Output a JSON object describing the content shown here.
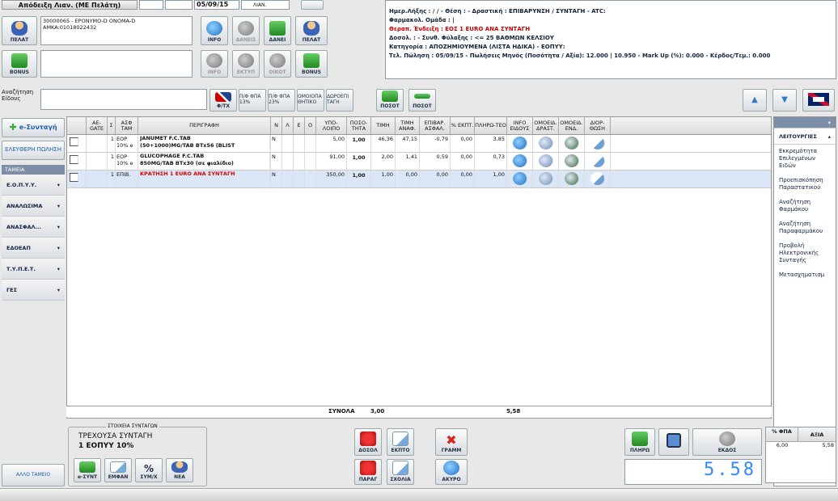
{
  "top": {
    "receipt_title": "Απόδειξη Λιαν. (ΜΕ Πελάτη)",
    "date": "05/09/15",
    "type": "ΛΙΑΝ."
  },
  "patient": {
    "line1": "30000065 - EPONYMO-D ONOMA-D",
    "line2": "AMKA:01018022432"
  },
  "buttons": {
    "pelat": "ΠΕΛΑΤ",
    "info": "INFO",
    "daneis": "ΔΑΝΕΙΣ",
    "daneis2": "ΔΑΝΕΙ",
    "pelat2": "ΠΕΛΑΤ",
    "bonus": "BONUS",
    "info2": "INFO",
    "ekty": "ΕΚΤΥΠ",
    "oikot": "ΟΙΚΟΤ",
    "bonus2": "BONUS",
    "search": "Αναζήτηση Είδους",
    "fpa_tx": "Φ/ΤΧ",
    "pf13": "Π/Φ ΦΠΑ 13%",
    "pf23": "Π/Φ ΦΠΑ 23%",
    "omoiop": "ΟΜΟΙΟΠΑ ΘΗΤΙΚΟ",
    "dwroep": "ΔΩΡΟΕΠΙ ΤΑΓΗ",
    "poso1": "ΠΟΣΟΤ",
    "poso2": "ΠΟΣΟΤ"
  },
  "info_panel": {
    "l1": "Ημερ.Λήξης :  / /  - Θέση :  - Δραστική : ΕΠΙΒΑΡΥΝΣΗ / ΣΥΝΤΑΓΗ - ATC:",
    "l2": "Φαρμακολ. Ομάδα : |",
    "l3": "Θεραπ. Ένδειξη : ΕΟΣ 1 EURO ΑΝΑ ΣΥΝΤΑΓΗ",
    "l4": "Δοσολ. :  - Συνθ. Φύλαξης : <= 25 ΒΑΘΜΩΝ ΚΕΛΣΙΟΥ",
    "l5": "Κατηγορία : ΑΠΟΖΗΜΙΟΥΜΕΝΑ (ΛΙΣΤΑ ΗΔΙΚΑ) - ΕΟΠΥΥ:",
    "l6": "Τελ. Πώληση : 05/09/15 - Πωλήσεις Μηνός (Ποσότητα / Αξία): 12.000 | 10.950 - Mark Up (%): 0.000 - Κέρδος/Τεμ.: 0.000"
  },
  "left_nav": {
    "esyntagi": "e-Συνταγή",
    "free": "ΕΛΕΥΘΕΡΗ ΠΩΛΗΣΗ",
    "tameia": "ΤΑΜΕΙΑ",
    "items": [
      "Ε.Ο.Π.Υ.Υ.",
      "ΑΝΑΛΩΣΙΜΑ",
      "ΑΝΑΣΦΑΛ...",
      "ΕΔΟΕΑΠ",
      "Τ.Υ.Π.Ε.Τ.",
      "ΓΕΣ"
    ],
    "other": "ΑΛΛΟ ΤΑΜΕΙΟ"
  },
  "grid": {
    "headers": [
      "ΑΕ-GATE",
      "Σ",
      "ΑΣΦ ΤΑΜ",
      "ΠΕΡΙΓΡΑΦΗ",
      "Ν",
      "Λ",
      "Ε",
      "Ο",
      "ΥΠΟ-ΛΟΙΠΟ",
      "ΠΟΣΟ-ΤΗΤΑ",
      "ΤΙΜΗ",
      "ΤΙΜΗ ΑΝΑΦ.",
      "ΕΠΙΒΑΡ. ΑΣΦΑΛ.",
      "% ΕΚΠΤ.",
      "ΠΛΗΡΩ-ΤΕΟ",
      "INFO ΕΙΔΟΥΣ",
      "ΟΜΟΕΙΔ. ΔΡΑΣΤ.",
      "ΟΜΟΕΙΔ. ΕΝΔ.",
      "ΔΙΟΡ-ΘΩΣΗ"
    ],
    "rows": [
      {
        "s": "1",
        "asf": "EOP 10% e",
        "desc1": "JANUMET F.C.TAB",
        "desc2": "(50+1000)MG/TAB BTx56 (BLIST",
        "n": "N",
        "ypol": "5,00",
        "qty": "1,00",
        "timi": "46,36",
        "anaf": "47,15",
        "epib": "-0,79",
        "ekpt": "0,00",
        "plir": "3,85",
        "red": false
      },
      {
        "s": "1",
        "asf": "EOP 10% e",
        "desc1": "GLUCOPHAGE F.C.TAB",
        "desc2": "850MG/TAB BTx30 (σε φιαλίδιο)",
        "n": "N",
        "ypol": "91,00",
        "qty": "1,00",
        "timi": "2,00",
        "anaf": "1,41",
        "epib": "0,59",
        "ekpt": "0,00",
        "plir": "0,73",
        "red": false
      },
      {
        "s": "1",
        "asf": "ΕΠΙΒ.",
        "desc1": "ΚΡΑΤΗΣΗ 1 EURO ΑΝΑ ΣΥΝΤΑΓΗ",
        "desc2": "",
        "n": "N",
        "ypol": "350,00",
        "qty": "1,00",
        "timi": "1,00",
        "anaf": "0,00",
        "epib": "0,00",
        "ekpt": "0,00",
        "plir": "1,00",
        "red": true
      }
    ],
    "totals_label": "ΣΥΝΟΛΑ",
    "totals_qty": "3,00",
    "totals_pay": "5,58"
  },
  "right_menu": {
    "title": "ΛΕΙΤΟΥΡΓΙΕΣ",
    "items": [
      "Εκκρεμότητα Επιλεγμένων Ειδών",
      "Προεπισκόπηση Παραστατικού",
      "Αναζήτηση Φαρμάκου",
      "Αναζήτηση Παραφαρμάκου",
      "Προβολή Ηλεκτρονικής Συνταγής",
      "Μετασχηματισμ"
    ]
  },
  "bottom": {
    "group_label": "ΣΤΟΙΧΕΙΑ ΣΥΝΤΑΓΩΝ",
    "current": "ΤΡΕΧΟΥΣΑ ΣΥΝΤΑΓΗ",
    "current2": "1  ΕΟΠΥΥ 10%",
    "b1": "e-ΣΥΝΤ",
    "b2": "ΕΜΦΑΝ",
    "b3": "ΣΥΜ/Χ",
    "b4": "ΝΕΑ",
    "doso": "ΔΟΣΟΛ",
    "ekpto": "ΕΚΠΤΟ",
    "gramm": "ΓΡΑΜΜ",
    "parag": "ΠΑΡΑΓ",
    "sxolia": "ΣΧΟΛΙΑ",
    "akyro": "ΑΚΥΡΟ",
    "plir": "ΠΛΗΡΩ",
    "ekdos": "ΕΚΔΟΣ",
    "display": "5.58",
    "fpa_hdr": "% ΦΠΑ",
    "axia_hdr": "ΑΞΙΑ",
    "fpa_val": "6,00",
    "axia_val": "5,58"
  }
}
